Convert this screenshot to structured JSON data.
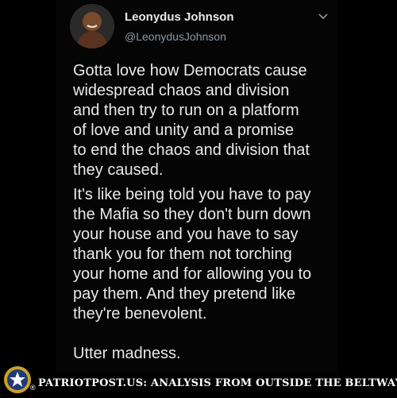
{
  "tweet": {
    "author_name": "Leonydus Johnson",
    "author_handle": "@LeonydusJohnson",
    "paragraphs": [
      "Gotta love how Democrats cause\nwidespread chaos and division\nand then try to run on a platform\nof love and unity and a promise\nto end the chaos and division that\nthey caused.",
      "It's like being told you have to pay\nthe Mafia so they don't burn down\nyour house and you have to say\nthank you for them not torching\nyour home and for allowing you to\npay them. And they pretend like\nthey're benevolent.",
      "Utter madness."
    ],
    "menu_icon": "chevron-down-icon",
    "avatar_icon": "profile-photo"
  },
  "footer": {
    "registered_mark": "®",
    "banner_text": "PATRIOTPOST.US: ANALYSIS FROM OUTSIDE THE BELTWAY",
    "logo_icon": "star-seal-icon",
    "colors": {
      "seal_ring": "#c9a227",
      "seal_inner": "#1f3a78",
      "star": "#ffffff"
    }
  }
}
